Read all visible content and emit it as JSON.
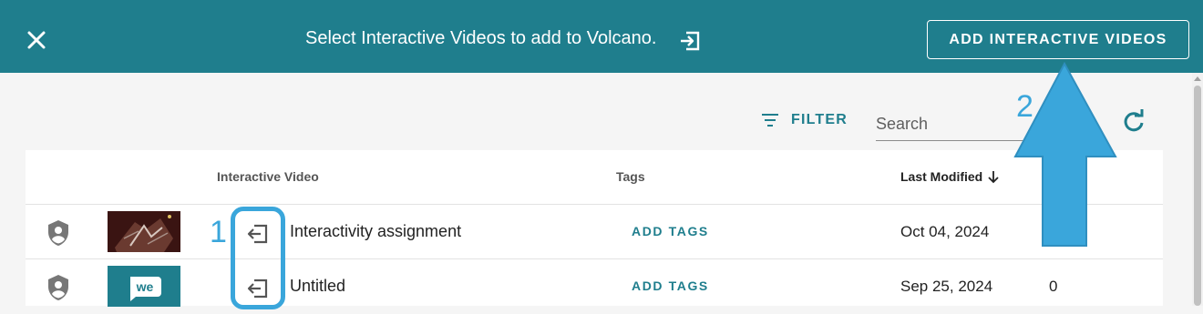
{
  "topbar": {
    "title": "Select Interactive Videos to add to Volcano.",
    "add_button_label": "ADD INTERACTIVE VIDEOS",
    "bg_color": "#1f7e8d"
  },
  "toolbar": {
    "filter_label": "FILTER",
    "search_placeholder": "Search"
  },
  "table": {
    "headers": {
      "interactive_video": "Interactive Video",
      "tags": "Tags",
      "last_modified": "Last Modified"
    },
    "rows": [
      {
        "title": "Interactivity assignment",
        "tags_action": "ADD TAGS",
        "last_modified": "Oct 04, 2024",
        "count": ""
      },
      {
        "title": "Untitled",
        "tags_action": "ADD TAGS",
        "last_modified": "Sep 25, 2024",
        "count": "0"
      }
    ]
  },
  "thumbnail_text": "we",
  "callouts": [
    "1",
    "2"
  ],
  "callout_color": "#3aa6db"
}
